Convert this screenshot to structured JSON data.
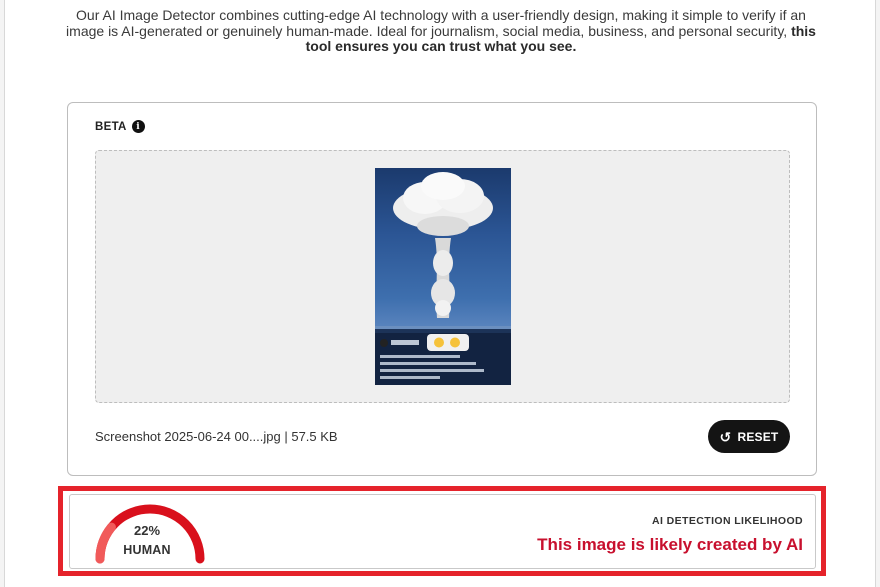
{
  "intro": {
    "text": "Our AI Image Detector combines cutting-edge AI technology with a user-friendly design, making it simple to verify if an image is AI-generated or genuinely human-made. Ideal for journalism, social media, business, and personal security,",
    "bold": "this tool ensures you can trust what you see."
  },
  "uploader": {
    "beta_label": "BETA",
    "file_info": "Screenshot 2025-06-24 00....jpg | 57.5 KB",
    "reset_label": "RESET"
  },
  "result": {
    "human_percent_label": "22%",
    "human_percent": 22,
    "human_label": "HUMAN",
    "title": "AI DETECTION LIKELIHOOD",
    "verdict": "This image is likely created by AI"
  },
  "colors": {
    "accent_red": "#c8102e",
    "highlight_border": "#e5232b",
    "button_dark": "#141414"
  }
}
